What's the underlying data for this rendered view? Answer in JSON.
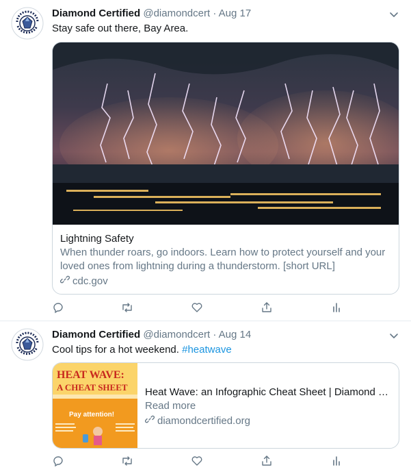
{
  "tweets": [
    {
      "author_name": "Diamond Certified",
      "handle": "@diamondcert",
      "separator": "·",
      "date": "Aug 17",
      "text": "Stay safe out there, Bay Area.",
      "card": {
        "title": "Lightning Safety",
        "description": "When thunder roars, go indoors. Learn how to protect yourself and your loved ones from lightning during a thunderstorm. [short URL]",
        "domain": "cdc.gov"
      }
    },
    {
      "author_name": "Diamond Certified",
      "handle": "@diamondcert",
      "separator": "·",
      "date": "Aug 14",
      "text_plain": "Cool tips for a hot weekend. ",
      "hashtag": "#heatwave",
      "card": {
        "title": "Heat Wave: an Infographic Cheat Sheet | Diamond C...",
        "description": "Read more",
        "domain": "diamondcertified.org",
        "thumb_heading_1": "HEAT WAVE:",
        "thumb_heading_2": "A CHEAT SHEET",
        "thumb_callout": "Pay attention!"
      }
    }
  ],
  "avatar_text": {
    "top": "DIAMOND",
    "bottom": "CERTIFIED"
  },
  "colors": {
    "link": "#1b95e0",
    "secondary_text": "#657786",
    "border": "#ccd6dd",
    "heat_banner": "#f29a1f",
    "heat_title": "#c8281e"
  },
  "icons": [
    "chevron-down-icon",
    "reply-icon",
    "retweet-icon",
    "like-icon",
    "share-icon",
    "analytics-icon",
    "link-icon"
  ]
}
